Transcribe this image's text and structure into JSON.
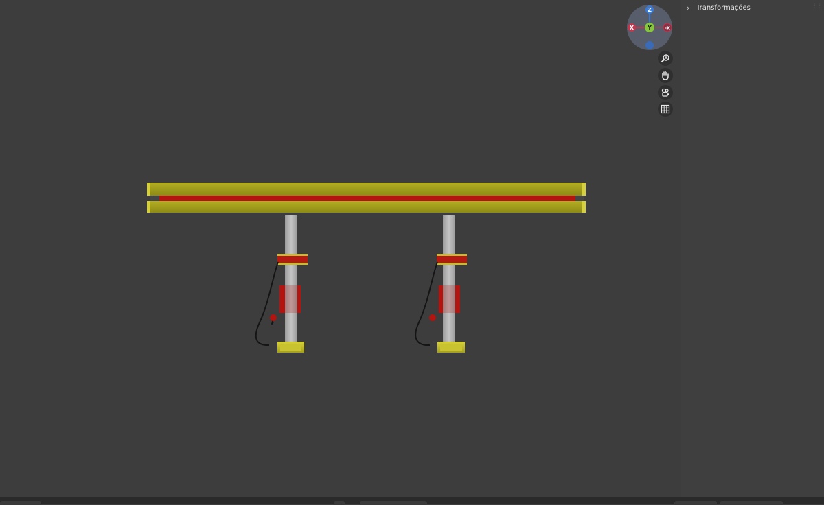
{
  "sidebar": {
    "panel_title": "Transformações"
  },
  "gizmo": {
    "axis_z_label": "Z",
    "axis_y_label": "Y",
    "axis_x_label": "X",
    "axis_neg_x_label": "-X",
    "colors": {
      "x": "#c0384f",
      "y": "#86c63c",
      "z": "#3a7ad6",
      "disc": "#5a6170"
    }
  },
  "nav_buttons": [
    {
      "icon": "zoom-icon"
    },
    {
      "icon": "hand-pan-icon"
    },
    {
      "icon": "camera-icon"
    },
    {
      "icon": "grid-icon"
    }
  ],
  "scene_colors": {
    "background": "#3d3d3d",
    "beam_yellow": "#a8a51c",
    "beam_red": "#b3140f",
    "post_grey": "#b8b8b8"
  }
}
